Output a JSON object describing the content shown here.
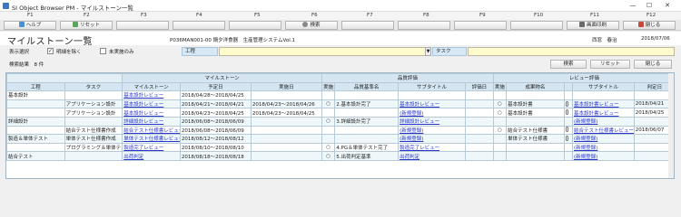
{
  "window": {
    "title": "SI Object Browser PM - マイルストーン一覧",
    "minimize": "—",
    "maximize": "☐",
    "close": "✕"
  },
  "fkeys": [
    "F1",
    "F2",
    "F3",
    "F4",
    "F5",
    "F6",
    "F7",
    "F8",
    "F9",
    "F10",
    "F11",
    "F12"
  ],
  "toolbar": {
    "help": "ヘルプ",
    "reset": "リセット",
    "search": "検索",
    "print": "画面印刷",
    "close": "閉じる"
  },
  "header": {
    "page_title": "マイルストーン一覧",
    "project": "P036MAN001-00 鍋夕洋食器　生産管理システムVol.1",
    "user": "西窓　春治",
    "date": "2018/07/06"
  },
  "filters": {
    "display_label": "表示選択",
    "exclude_label": "明細を除く",
    "incomplete_label": "未実施のみ",
    "process_label": "工程",
    "task_label": "タスク"
  },
  "results": {
    "count_text": "検索結果　8 件",
    "search": "検索",
    "reset": "リセット",
    "close": "閉じる"
  },
  "grid": {
    "group_headers": {
      "milestone": "マイルストーン",
      "quality": "品質評価",
      "review": "レビュー評価"
    },
    "columns": [
      "工程",
      "タスク",
      "マイルストーン",
      "予定日",
      "実施日",
      "実施",
      "品質基準名",
      "サブタイトル",
      "評価日",
      "実施",
      "成果物名",
      "",
      "サブタイトル",
      "判定日"
    ],
    "rows": [
      [
        "基本設計",
        "",
        "基本設計レビュー",
        "2018/04/28～2018/04/25",
        "",
        "",
        "",
        "",
        "",
        "",
        "",
        "",
        "",
        ""
      ],
      [
        "",
        "アプリケーション設計",
        "基本設計レビュー",
        "2018/04/21～2018/04/21",
        "2018/04/23～2018/04/26",
        "○",
        "2.基本設計完了",
        "基本設計レビュー",
        "",
        "○",
        "基本設計書",
        "clip",
        "基本設計書レビュー",
        "2018/04/21"
      ],
      [
        "",
        "アプリケーション設計",
        "基本設計レビュー",
        "2018/04/23～2018/04/25",
        "2018/04/23～2018/04/25",
        "",
        "",
        "(新規登録)",
        "",
        "○",
        "基本設計書",
        "clip",
        "基本設計書レビュー",
        "2018/04/25"
      ],
      [
        "詳細設計",
        "",
        "詳細設計レビュー",
        "2018/06/08～2018/06/09",
        "",
        "○",
        "3.詳細設計完了",
        "詳細設計レビュー",
        "",
        "",
        "",
        "",
        "(新規登録)",
        ""
      ],
      [
        "",
        "結合テスト仕様書作成",
        "結合テスト仕様書レビュー",
        "2018/06/08～2018/06/09",
        "",
        "",
        "",
        "(新規登録)",
        "",
        "○",
        "結合テスト仕様書",
        "clip",
        "結合テスト仕様書レビュー",
        "2018/06/07"
      ],
      [
        "製造＆単体テスト",
        "単体テスト仕様書作成",
        "単体テスト仕様書レビュー",
        "2018/08/12～2018/08/12",
        "",
        "",
        "",
        "(新規登録)",
        "",
        "",
        "単体テスト仕様書",
        "clip",
        "(新規登録)",
        ""
      ],
      [
        "",
        "プログラミング＆単体テスト",
        "製造完了レビュー",
        "2018/08/10～2018/08/10",
        "",
        "○",
        "4.PG＆単体テスト完了",
        "製造完了レビュー",
        "",
        "",
        "",
        "",
        "(新規登録)",
        ""
      ],
      [
        "結合テスト",
        "",
        "出荷判定",
        "2018/08/18～2018/08/18",
        "",
        "○",
        "5.出荷判定基準",
        "出荷判定",
        "",
        "",
        "",
        "",
        "(新規登録)",
        ""
      ]
    ]
  },
  "colors": {
    "header_bg": "#d5e6f2",
    "link": "#2a36c8",
    "input_yellow": "#fffbcc"
  }
}
